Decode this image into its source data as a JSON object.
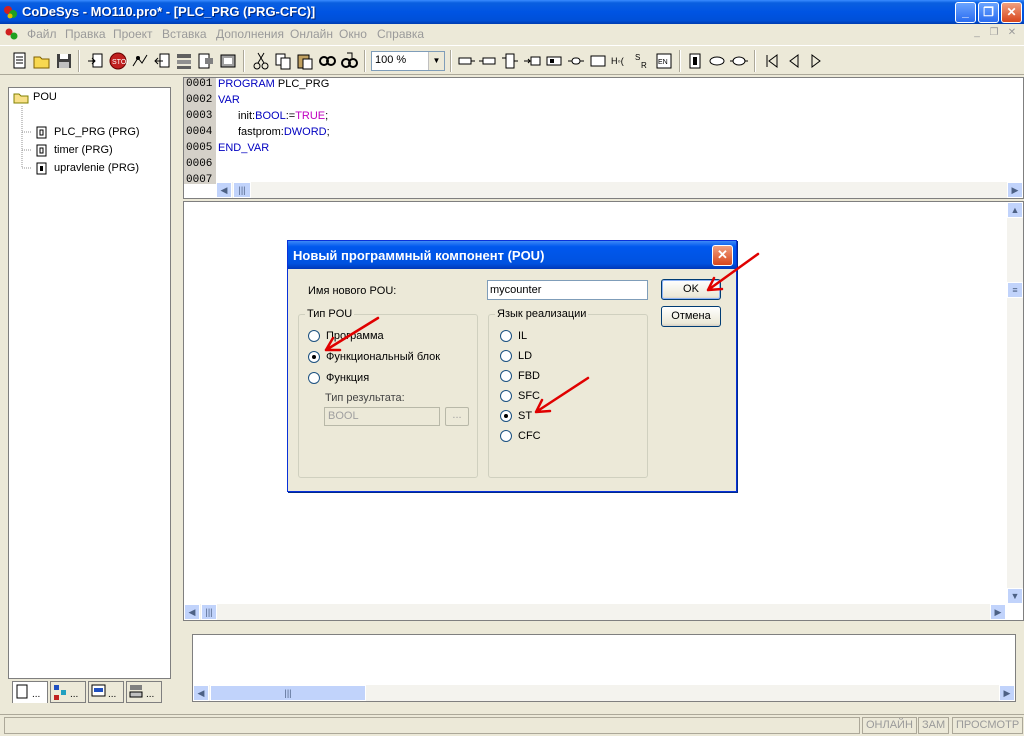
{
  "window": {
    "title": "CoDeSys - MO110.pro* - [PLC_PRG (PRG-CFC)]"
  },
  "menu": {
    "items": [
      "Файл",
      "Правка",
      "Проект",
      "Вставка",
      "Дополнения",
      "Онлайн",
      "Окно",
      "Справка"
    ]
  },
  "toolbar": {
    "zoom": "100 %"
  },
  "tree": {
    "root": "POU",
    "items": [
      "PLC_PRG (PRG)",
      "timer (PRG)",
      "upravlenie (PRG)"
    ]
  },
  "editor": {
    "line_numbers": [
      "0001",
      "0002",
      "0003",
      "0004",
      "0005",
      "0006",
      "0007"
    ],
    "line1_kw": "PROGRAM",
    "line1_rest": " PLC_PRG",
    "line2_kw": "VAR",
    "line3_name": "init:",
    "line3_type": "BOOL",
    "line3_assign": ":=",
    "line3_value": "TRUE",
    "line3_end": ";",
    "line4_name": "fastprom:",
    "line4_type": "DWORD",
    "line4_end": ";",
    "line5_kw": "END_VAR"
  },
  "statusbar": {
    "online": "ОНЛАЙН",
    "zam": "ЗАМ",
    "view": "ПРОСМОТР"
  },
  "dialog": {
    "title": "Новый программный компонент (POU)",
    "name_label": "Имя нового POU:",
    "name_value": "mycounter",
    "ok": "OK",
    "cancel": "Отмена",
    "pou_type": {
      "title": "Тип POU",
      "options": [
        "Программа",
        "Функциональный блок",
        "Функция"
      ],
      "selected": "Функциональный блок",
      "result_label": "Тип результата:",
      "result_value": "BOOL",
      "browse": "..."
    },
    "language": {
      "title": "Язык реализации",
      "options": [
        "IL",
        "LD",
        "FBD",
        "SFC",
        "ST",
        "CFC"
      ],
      "selected": "ST"
    }
  },
  "colors": {
    "titlebar": "#0054e3",
    "keyword": "#0000c0",
    "literal": "#c000c0",
    "annotation_arrow": "#e00000"
  }
}
